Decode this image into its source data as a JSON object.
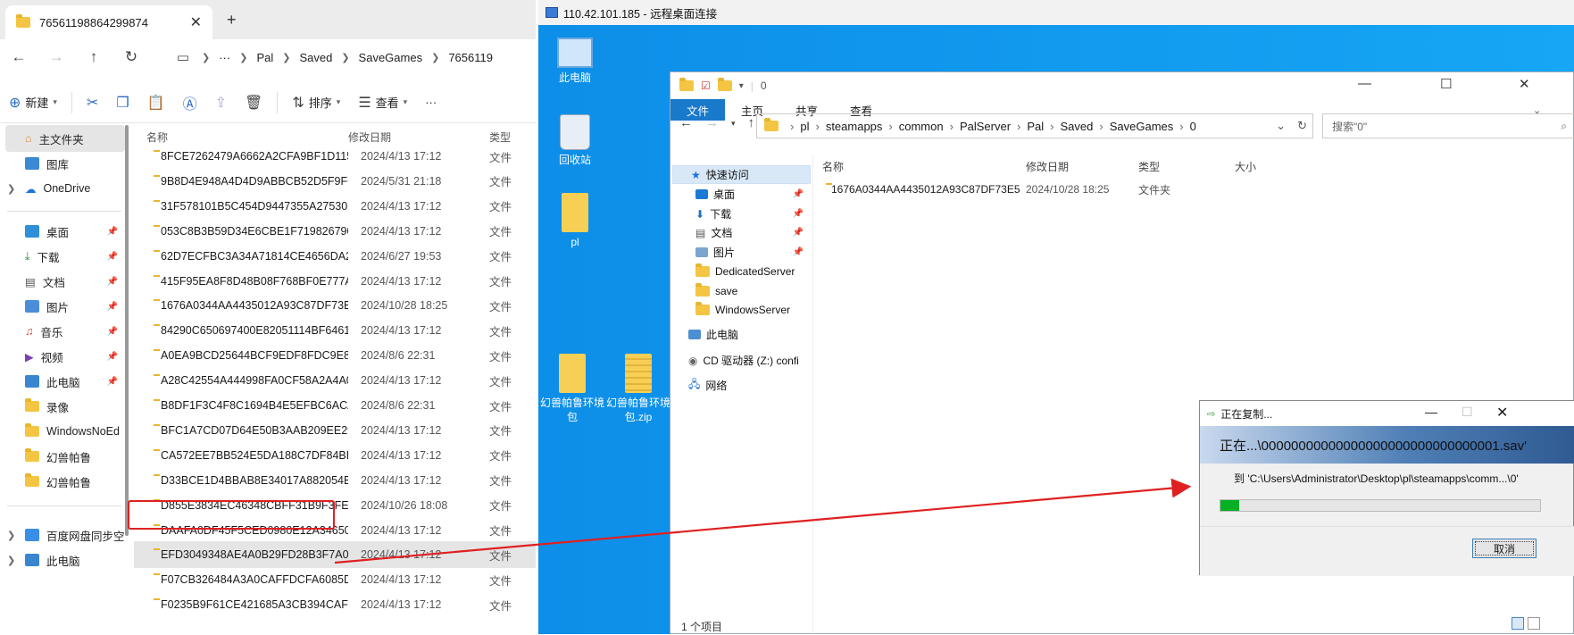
{
  "left_explorer": {
    "tab_title": "76561198864299874",
    "breadcrumb": [
      "Pal",
      "Saved",
      "SaveGames",
      "7656119"
    ],
    "more_glyph": "···",
    "commands": {
      "new": "新建",
      "sort": "排序",
      "view": "查看",
      "more": "···"
    },
    "sidebar": {
      "home": "主文件夹",
      "gallery": "图库",
      "onedrive": "OneDrive",
      "desktop": "桌面",
      "downloads": "下载",
      "documents": "文档",
      "pictures": "图片",
      "music": "音乐",
      "videos": "视频",
      "thispc": "此电脑",
      "recordings": "录像",
      "windowsnoed": "WindowsNoEd",
      "pal1": "幻兽帕鲁",
      "pal2": "幻兽帕鲁",
      "baidu": "百度网盘同步空",
      "thispc2": "此电脑"
    },
    "columns": {
      "name": "名称",
      "date": "修改日期",
      "type": "类型"
    },
    "type_label": "文件",
    "rows": [
      {
        "name": "8FCE7262479A6662A2CFA9BF1D1154...",
        "date": "2024/4/13 17:12"
      },
      {
        "name": "9B8D4E948A4D4D9ABBCB52D5F9FC1...",
        "date": "2024/5/31 21:18"
      },
      {
        "name": "31F578101B5C454D9447355A275305...",
        "date": "2024/4/13 17:12"
      },
      {
        "name": "053C8B3B59D34E6CBE1F7198267901...",
        "date": "2024/4/13 17:12"
      },
      {
        "name": "62D7ECFBC3A34A71814CE4656DA28...",
        "date": "2024/6/27 19:53"
      },
      {
        "name": "415F95EA8F8D48B08F768BF0E777A2...",
        "date": "2024/4/13 17:12"
      },
      {
        "name": "1676A0344AA4435012A93C87DF73E5...",
        "date": "2024/10/28 18:25"
      },
      {
        "name": "84290C650697400E82051114BF646180",
        "date": "2024/4/13 17:12"
      },
      {
        "name": "A0EA9BCD25644BCF9EDF8FDC9E895...",
        "date": "2024/8/6 22:31"
      },
      {
        "name": "A28C42554A444998FA0CF58A2A4A08...",
        "date": "2024/4/13 17:12"
      },
      {
        "name": "B8DF1F3C4F8C1694B4E5EFBC6ACA73...",
        "date": "2024/8/6 22:31"
      },
      {
        "name": "BFC1A7CD07D64E50B3AAB209EE29A...",
        "date": "2024/4/13 17:12"
      },
      {
        "name": "CA572EE7BB524E5DA188C7DF84BE2...",
        "date": "2024/4/13 17:12"
      },
      {
        "name": "D33BCE1D4BBAB8E34017A882054BE...",
        "date": "2024/4/13 17:12"
      },
      {
        "name": "D855E3834EC46348CBFF31B9F3FE9336",
        "date": "2024/10/26 18:08"
      },
      {
        "name": "DAAFA0DF45F5CED0980E12A346504...",
        "date": "2024/4/13 17:12"
      },
      {
        "name": "EFD3049348AE4A0B29FD28B3F7A099...",
        "date": "2024/4/13 17:12"
      },
      {
        "name": "F07CB326484A3A0CAFFDCFA6085DD...",
        "date": "2024/4/13 17:12"
      },
      {
        "name": "F0235B9F61CE421685A3CB394CAF52...",
        "date": "2024/4/13 17:12"
      }
    ]
  },
  "remote": {
    "title": "110.42.101.185 - 远程桌面连接",
    "desktop_icons": {
      "thispc": "此电脑",
      "recycle": "回收站",
      "pl": "pl",
      "env": "幻兽帕鲁环境包",
      "envzip": "幻兽帕鲁环境包.zip"
    }
  },
  "inner_explorer": {
    "title": "0",
    "ribbon": [
      "文件",
      "主页",
      "共享",
      "查看"
    ],
    "path": [
      "pl",
      "steamapps",
      "common",
      "PalServer",
      "Pal",
      "Saved",
      "SaveGames",
      "0"
    ],
    "search_placeholder": "搜索\"0\"",
    "nav": {
      "quick": "快速访问",
      "desktop": "桌面",
      "downloads": "下载",
      "documents": "文档",
      "pictures": "图片",
      "dedicated": "DedicatedServer",
      "save": "save",
      "winserver": "WindowsServer",
      "thispc": "此电脑",
      "cd": "CD 驱动器 (Z:) confi",
      "network": "网络"
    },
    "columns": {
      "name": "名称",
      "date": "修改日期",
      "type": "类型",
      "size": "大小"
    },
    "row": {
      "name": "1676A0344AA4435012A93C87DF73E5...",
      "date": "2024/10/28 18:25",
      "type": "文件夹"
    },
    "status": "1 个项目"
  },
  "copy_dialog": {
    "title": "正在复制...",
    "banner": "正在...\\00000000000000000000000000000001.sav'",
    "to": "到 'C:\\Users\\Administrator\\Desktop\\pl\\steamapps\\comm...\\0'",
    "progress": 0.06,
    "cancel": "取消"
  }
}
